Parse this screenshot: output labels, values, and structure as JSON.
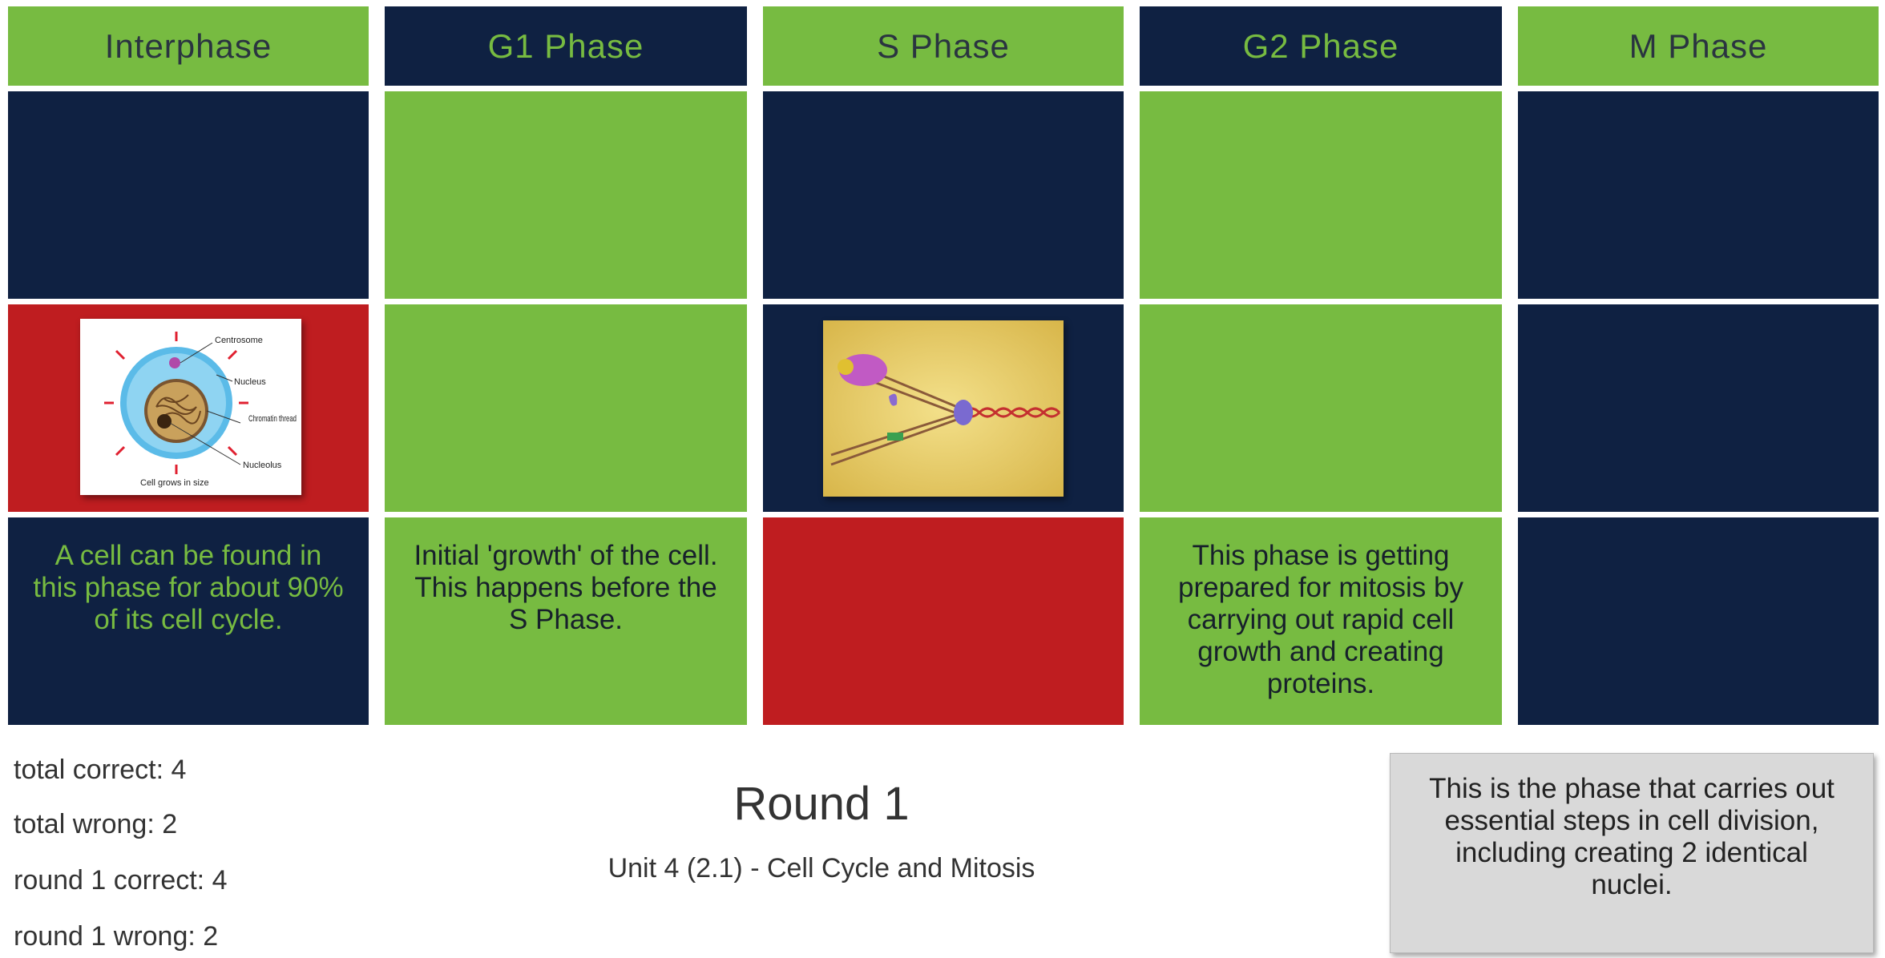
{
  "headers": [
    "Interphase",
    "G1 Phase",
    "S Phase",
    "G2 Phase",
    "M Phase"
  ],
  "clues": {
    "interphase": "A cell can be found in this phase for about 90% of its cell cycle.",
    "g1": "Initial 'growth' of the cell. This happens before the S Phase.",
    "g2": "This phase is getting prepared for mitosis by carrying out rapid cell growth and creating proteins."
  },
  "cell_diagram": {
    "labels": [
      "Centrosome",
      "Nucleus",
      "Chromatin thread",
      "Nucleolus",
      "Cell grows in size"
    ]
  },
  "stats": {
    "total_correct": "total correct: 4",
    "total_wrong": "total wrong: 2",
    "round_correct": "round 1 correct: 4",
    "round_wrong": "round 1 wrong: 2"
  },
  "round": {
    "title": "Round 1",
    "subtitle": "Unit 4 (2.1) - Cell Cycle and Mitosis"
  },
  "prompt": "This is the phase that carries out essential steps in cell division, including creating 2 identical nuclei.",
  "colors": {
    "green": "#77bb41",
    "navy": "#0f2142",
    "red": "#bf1d20",
    "card_gray": "#d9d9d9"
  },
  "icons": [
    "cell-diagram-image",
    "dna-replication-image"
  ]
}
